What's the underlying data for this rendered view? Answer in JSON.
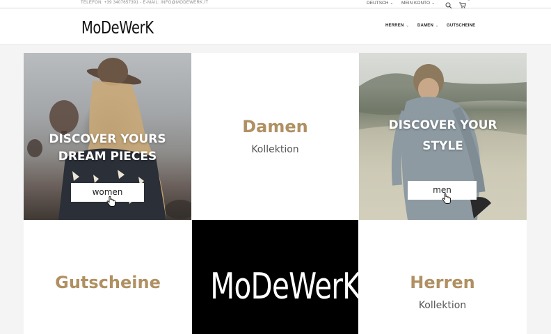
{
  "topbar": {
    "contact": "TELEFON: +39 3407657391 - E-MAIL: INFO@MODEWERK.IT",
    "language": "DEUTSCH",
    "account": "MEIN KONTO",
    "cart_count": "0",
    "icons": [
      "search-icon",
      "cart-icon"
    ]
  },
  "header": {
    "logo": "MoDeWerK",
    "nav": [
      {
        "label": "HERREN",
        "has_dropdown": true
      },
      {
        "label": "DAMEN",
        "has_dropdown": true
      },
      {
        "label": "GUTSCHEINE",
        "has_dropdown": false
      }
    ]
  },
  "tiles": {
    "women": {
      "title_line1": "DISCOVER YOURS",
      "title_line2": "DREAM PIECES",
      "button": "women"
    },
    "damen": {
      "title": "Damen",
      "subtitle": "Kollektion"
    },
    "men": {
      "title_line1": "DISCOVER YOUR",
      "title_line2": "STYLE",
      "button": "men"
    },
    "gutscheine": {
      "title": "Gutscheine"
    },
    "brand": {
      "logo": "MoDeWerK"
    },
    "herren": {
      "title": "Herren",
      "subtitle": "Kollektion"
    }
  },
  "colors": {
    "accent_gold": "#b09062",
    "brand_black": "#000000"
  }
}
